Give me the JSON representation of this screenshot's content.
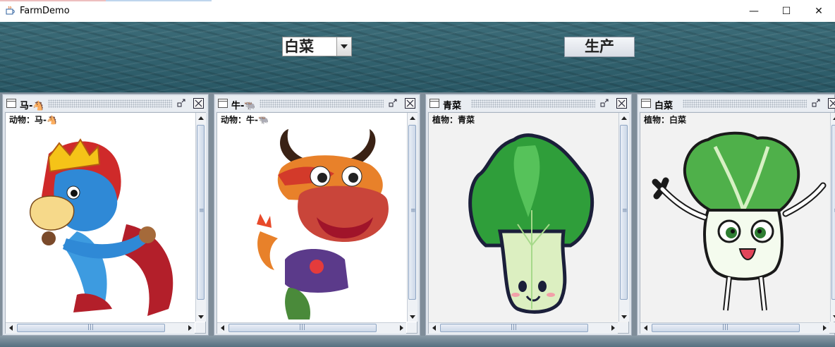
{
  "window": {
    "title": "FarmDemo",
    "minimize_glyph": "—",
    "maximize_glyph": "☐",
    "close_glyph": "✕"
  },
  "controls": {
    "combo_value": "白菜",
    "produce_label": "生产"
  },
  "frames": [
    {
      "title": "马-🐴",
      "label": "动物：马-🐴",
      "picture": "horse-cartoon"
    },
    {
      "title": "牛-🐃",
      "label": "动物：牛-🐃",
      "picture": "bull-cartoon"
    },
    {
      "title": "青菜",
      "label": "植物：青菜",
      "picture": "bok-choy-cartoon"
    },
    {
      "title": "白菜",
      "label": "植物：白菜",
      "picture": "napa-cabbage-cartoon"
    }
  ],
  "colors": {
    "ocean_dark": "#0f3442",
    "frame_bg": "#dfe5ec",
    "scroll_thumb": "#ccd8e8"
  }
}
